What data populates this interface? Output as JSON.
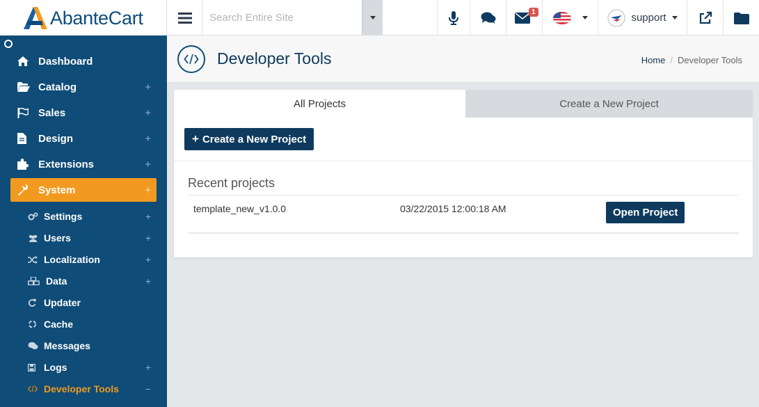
{
  "brand": {
    "name": "AbanteCart"
  },
  "topbar": {
    "search_placeholder": "Search Entire Site",
    "messages_badge": "1",
    "user_label": "support"
  },
  "sidebar": {
    "items": [
      {
        "label": "Dashboard",
        "icon": "home-icon",
        "has_plus": false
      },
      {
        "label": "Catalog",
        "icon": "folder-open-icon",
        "has_plus": true
      },
      {
        "label": "Sales",
        "icon": "flag-icon",
        "has_plus": true
      },
      {
        "label": "Design",
        "icon": "file-icon",
        "has_plus": true
      },
      {
        "label": "Extensions",
        "icon": "puzzle-icon",
        "has_plus": true
      },
      {
        "label": "System",
        "icon": "wrench-icon",
        "has_plus": true,
        "active": true
      }
    ],
    "subitems": [
      {
        "label": "Settings",
        "icon": "gears-icon",
        "toggle": "+"
      },
      {
        "label": "Users",
        "icon": "users-icon",
        "toggle": "+"
      },
      {
        "label": "Localization",
        "icon": "random-icon",
        "toggle": "+"
      },
      {
        "label": "Data",
        "icon": "cubes-icon",
        "toggle": "+"
      },
      {
        "label": "Updater",
        "icon": "refresh-icon",
        "toggle": ""
      },
      {
        "label": "Cache",
        "icon": "recycle-icon",
        "toggle": ""
      },
      {
        "label": "Messages",
        "icon": "comments-icon",
        "toggle": ""
      },
      {
        "label": "Logs",
        "icon": "save-icon",
        "toggle": "+"
      },
      {
        "label": "Developer Tools",
        "icon": "code-icon",
        "toggle": "−",
        "current": true
      }
    ]
  },
  "page": {
    "title": "Developer Tools",
    "breadcrumb": {
      "home": "Home",
      "separator": "/",
      "current": "Developer Tools"
    }
  },
  "tabs": {
    "all": "All Projects",
    "create": "Create a New Project"
  },
  "actions": {
    "create_button": "Create a New Project",
    "create_plus": "+"
  },
  "recent": {
    "title": "Recent projects",
    "projects": [
      {
        "name": "template_new_v1.0.0",
        "date": "03/22/2015 12:00:18 AM",
        "action": "Open Project"
      }
    ]
  },
  "colors": {
    "sidebar": "#0f4c77",
    "accent": "#f29a1f",
    "button": "#0f3a5e",
    "badge": "#d9534f"
  }
}
